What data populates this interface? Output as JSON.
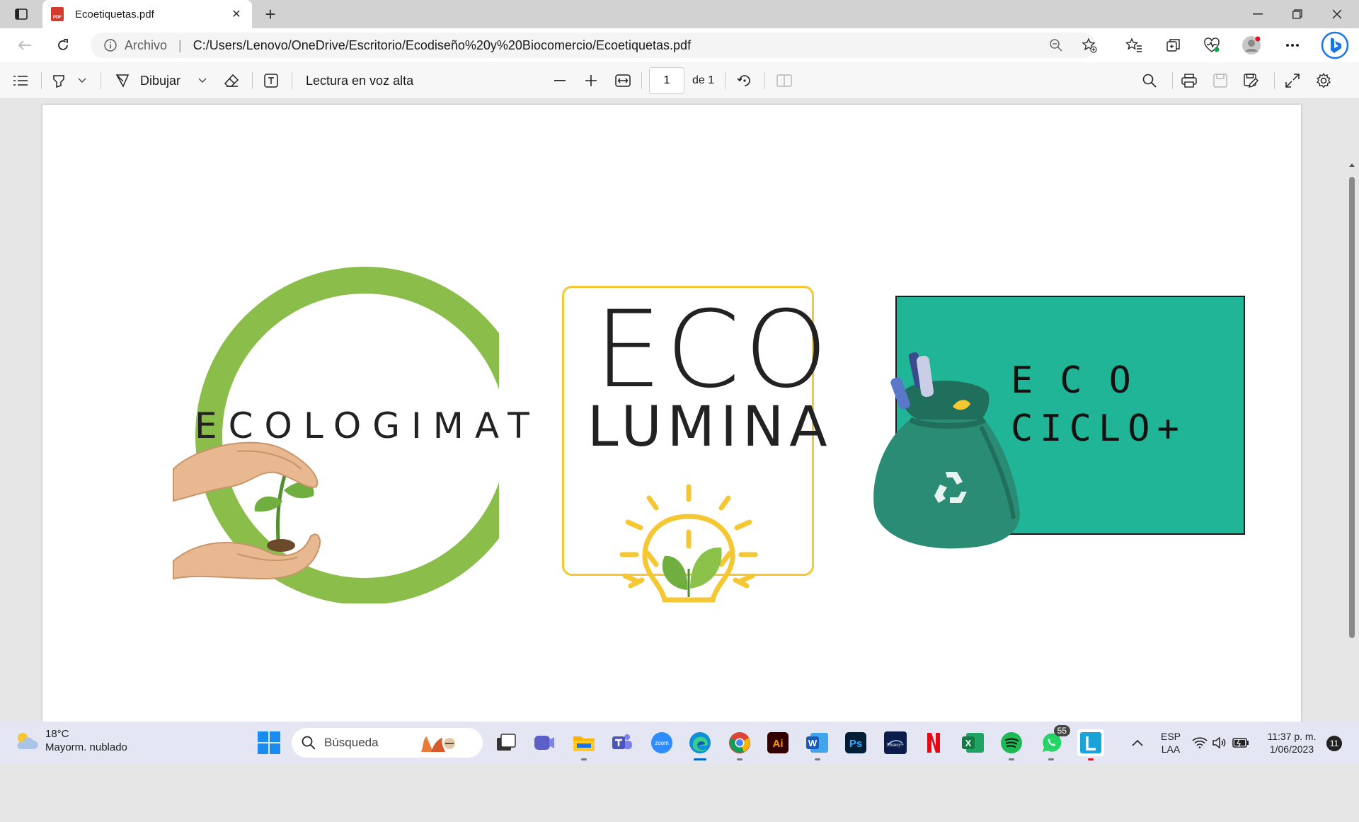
{
  "browser": {
    "tab_title": "Ecoetiquetas.pdf",
    "tab_icon_label": "PDF",
    "url_scheme": "Archivo",
    "url": "C:/Users/Lenovo/OneDrive/Escritorio/Ecodiseño%20y%20Biocomercio/Ecoetiquetas.pdf"
  },
  "pdf_toolbar": {
    "draw_label": "Dibujar",
    "read_aloud_label": "Lectura en voz alta",
    "page_current": "1",
    "page_total_label": "de 1"
  },
  "document": {
    "logo1_text": "ECOLOGIMAT",
    "logo2_line1": "ECO",
    "logo2_line2": "LUMINA",
    "logo3_line1": "ECO",
    "logo3_line2": "CICLO+",
    "colors": {
      "logo1_ring": "#8bbd4a",
      "logo2_frame": "#f4c733",
      "logo2_bulb": "#8bc34a",
      "logo3_background": "#1fb596",
      "logo3_bag": "#2a8c74"
    }
  },
  "taskbar": {
    "weather_temp": "18°C",
    "weather_desc": "Mayorm. nublado",
    "search_placeholder": "Búsqueda",
    "whatsapp_badge": "55",
    "language_line1": "ESP",
    "language_line2": "LAA",
    "time": "11:37 p. m.",
    "date": "1/06/2023",
    "notification_count": "11"
  }
}
